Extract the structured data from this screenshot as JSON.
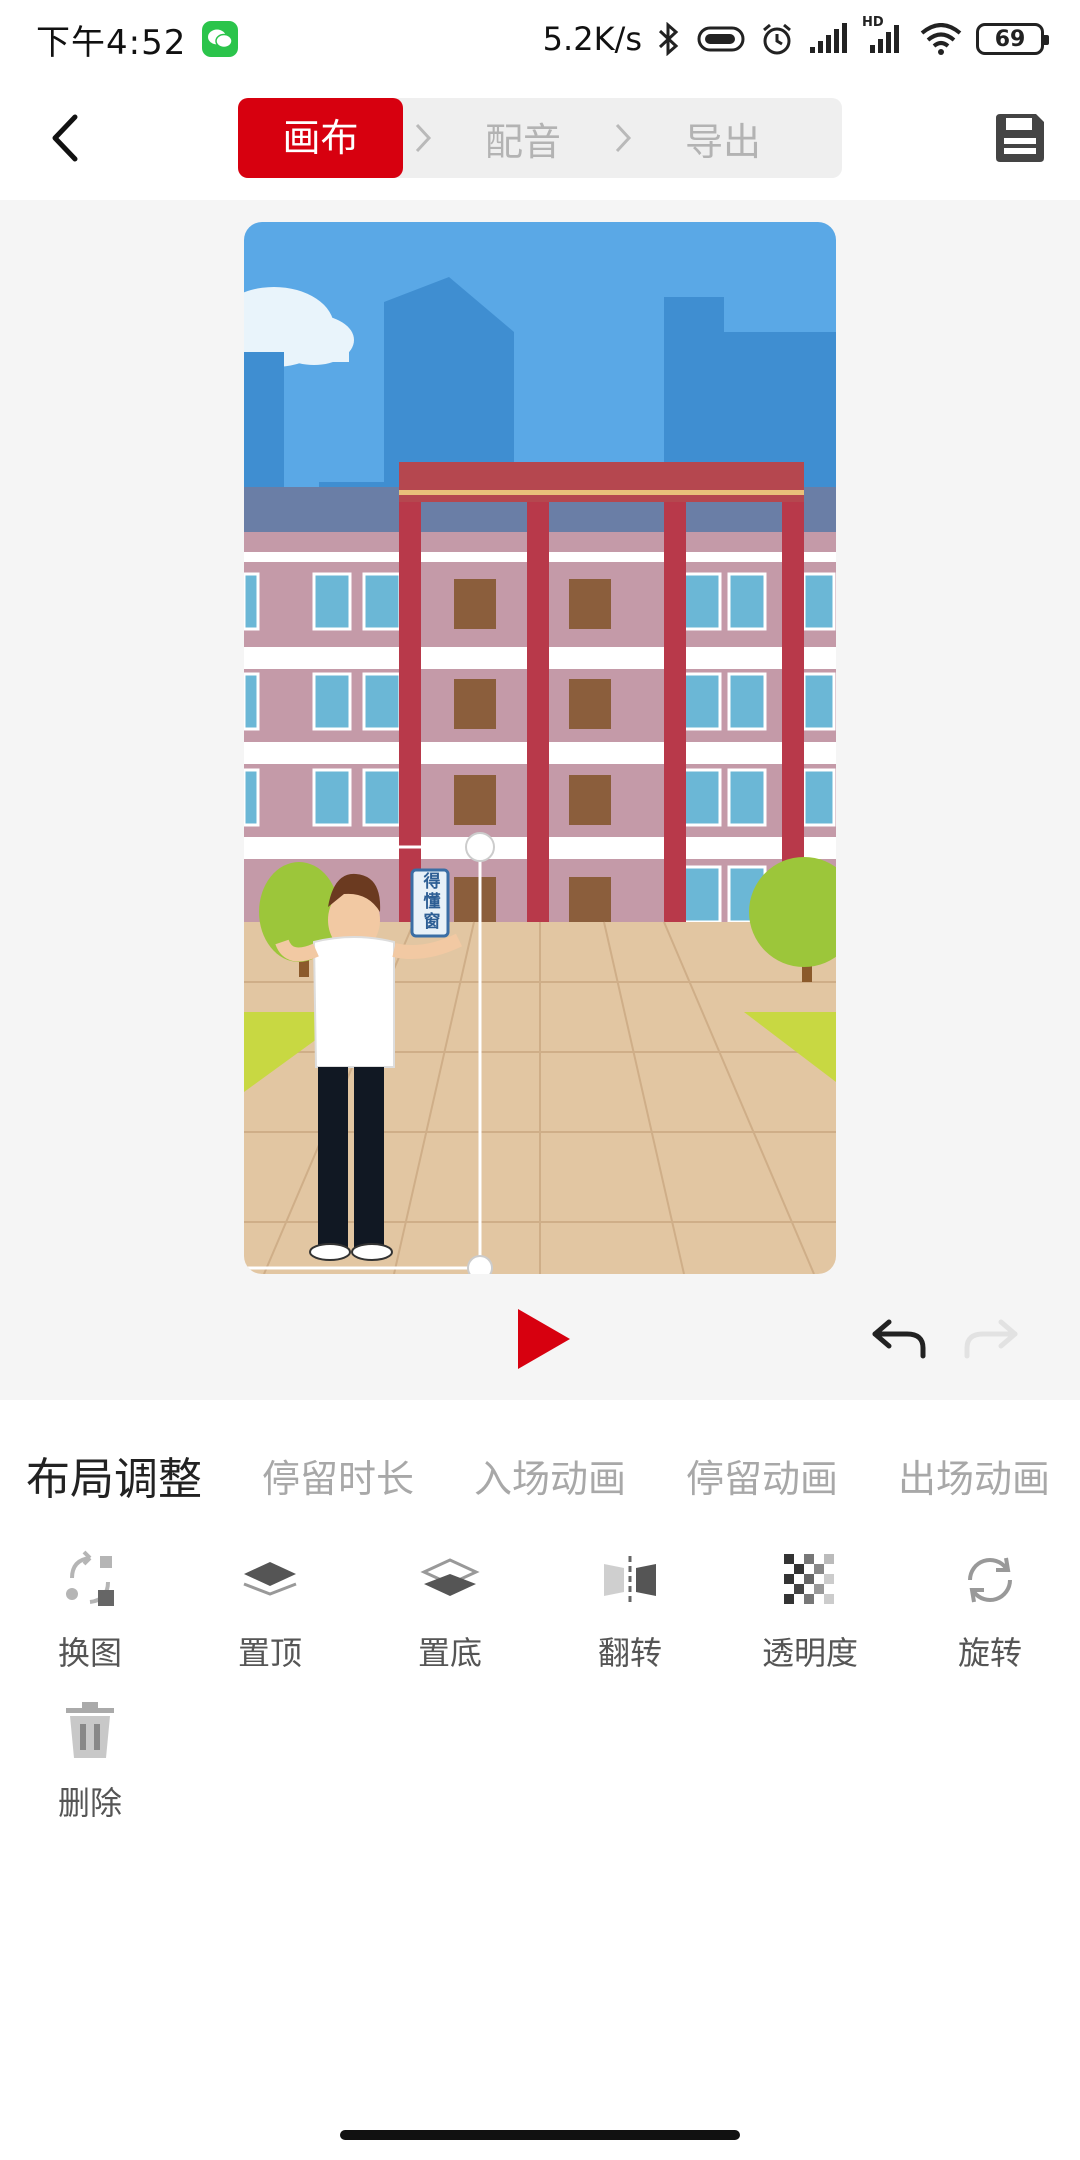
{
  "status_bar": {
    "time": "下午4:52",
    "net_speed": "5.2K/s",
    "battery": "69",
    "hd_label": "HD"
  },
  "header": {
    "steps": [
      {
        "label": "画布",
        "active": true
      },
      {
        "label": "配音",
        "active": false
      },
      {
        "label": "导出",
        "active": false
      }
    ]
  },
  "canvas": {
    "sign_text": "得\n懂\n窗"
  },
  "panel": {
    "tabs": [
      {
        "label": "布局调整",
        "active": true
      },
      {
        "label": "停留时长",
        "active": false
      },
      {
        "label": "入场动画",
        "active": false
      },
      {
        "label": "停留动画",
        "active": false
      },
      {
        "label": "出场动画",
        "active": false
      }
    ],
    "tools": [
      {
        "label": "换图",
        "icon": "replace-image-icon"
      },
      {
        "label": "置顶",
        "icon": "bring-to-front-icon"
      },
      {
        "label": "置底",
        "icon": "send-to-back-icon"
      },
      {
        "label": "翻转",
        "icon": "flip-icon"
      },
      {
        "label": "透明度",
        "icon": "opacity-icon"
      },
      {
        "label": "旋转",
        "icon": "rotate-icon"
      },
      {
        "label": "删除",
        "icon": "trash-icon"
      }
    ]
  },
  "colors": {
    "accent": "#d7000f",
    "tab_inactive": "#a8a8a8",
    "stage_bg": "#f5f5f5"
  }
}
